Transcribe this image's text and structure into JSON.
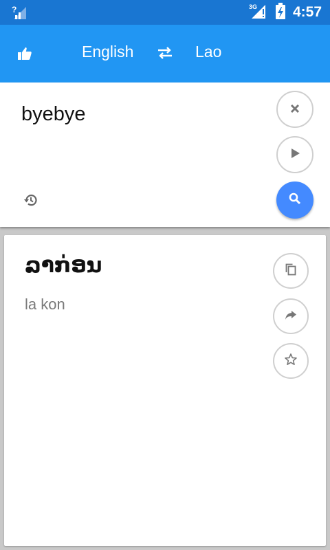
{
  "status_bar": {
    "network_label": "3G",
    "time": "4:57",
    "icons": [
      "signal-unknown-icon",
      "signal-3g-icon",
      "battery-charging-icon"
    ]
  },
  "app_bar": {
    "source_language": "English",
    "target_language": "Lao",
    "icons": [
      "thumbs-up-icon",
      "swap-arrows-icon"
    ]
  },
  "input": {
    "text": "byebye",
    "icons": [
      "history-icon",
      "clear-icon",
      "play-icon",
      "search-icon"
    ]
  },
  "output": {
    "translation": "ລາກ່ອນ",
    "transliteration": "la kon",
    "icons": [
      "copy-icon",
      "share-icon",
      "star-icon"
    ]
  },
  "colors": {
    "status_bar": "#1976d2",
    "app_bar": "#2196f3",
    "search_button": "#448aff",
    "background": "#c9c9c9"
  }
}
